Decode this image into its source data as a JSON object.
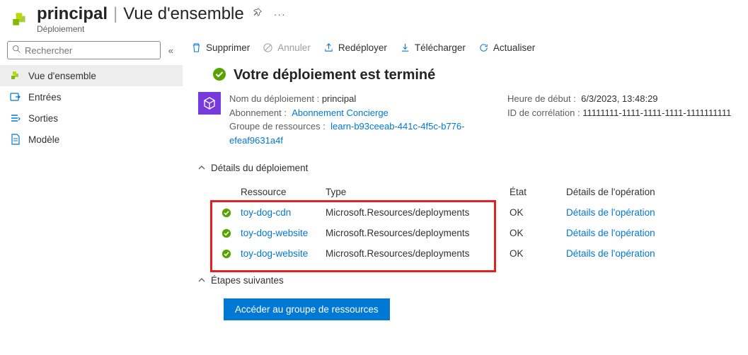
{
  "header": {
    "title": "principal",
    "section": "Vue d'ensemble",
    "subtitle": "Déploiement"
  },
  "sidebar": {
    "search_placeholder": "Rechercher",
    "items": [
      {
        "label": "Vue d'ensemble",
        "icon": "overview"
      },
      {
        "label": "Entrées",
        "icon": "inputs"
      },
      {
        "label": "Sorties",
        "icon": "outputs"
      },
      {
        "label": "Modèle",
        "icon": "template"
      }
    ]
  },
  "toolbar": {
    "delete": "Supprimer",
    "cancel": "Annuler",
    "redeploy": "Redéployer",
    "download": "Télécharger",
    "refresh": "Actualiser"
  },
  "status": {
    "title": "Votre déploiement est terminé"
  },
  "meta": {
    "deployment_name_label": "Nom du déploiement :",
    "deployment_name": "principal",
    "subscription_label": "Abonnement :",
    "subscription": "Abonnement Concierge",
    "resource_group_label": "Groupe de ressources :",
    "resource_group": "learn-b93ceeab-441c-4f5c-b776-efeaf9631a4f",
    "start_time_label": "Heure de début :",
    "start_time": "6/3/2023, 13:48:29",
    "correlation_label": "ID de corrélation :",
    "correlation": "11111111-1111-1111-1111-1111111111"
  },
  "details": {
    "header": "Détails du déploiement",
    "columns": {
      "resource": "Ressource",
      "type": "Type",
      "status": "État",
      "details": "Détails de l'opération"
    },
    "rows": [
      {
        "resource": "toy-dog-cdn",
        "type": "Microsoft.Resources/deployments",
        "status": "OK",
        "details": "Détails de l'opération"
      },
      {
        "resource": "toy-dog-website",
        "type": "Microsoft.Resources/deployments",
        "status": "OK",
        "details": "Détails de l'opération"
      },
      {
        "resource": "toy-dog-website",
        "type": "Microsoft.Resources/deployments",
        "status": "OK",
        "details": "Détails de l'opération"
      }
    ]
  },
  "next": {
    "header": "Étapes suivantes",
    "button": "Accéder au groupe de ressources"
  }
}
